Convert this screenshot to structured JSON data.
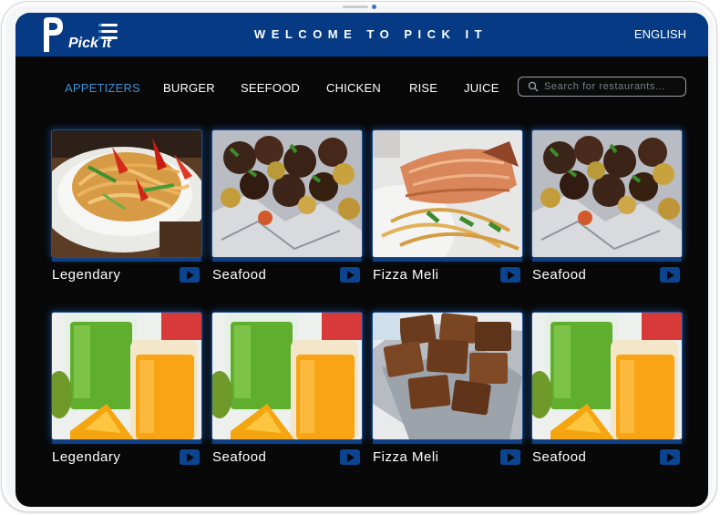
{
  "header": {
    "logo_text": "Pick it",
    "title": "WELCOME TO PICK IT",
    "language": "ENGLISH"
  },
  "nav": {
    "items": [
      {
        "label": "APPETIZERS",
        "active": true
      },
      {
        "label": "BURGER",
        "active": false
      },
      {
        "label": "SEEFOOD",
        "active": false
      },
      {
        "label": "CHICKEN",
        "active": false
      },
      {
        "label": "RISE",
        "active": false
      },
      {
        "label": "JUICE",
        "active": false
      }
    ]
  },
  "search": {
    "placeholder": "Search for restaurants..."
  },
  "cards": [
    {
      "name": "Legendary",
      "image": "noodles-plate"
    },
    {
      "name": "Seafood",
      "image": "roasted-meat-foil"
    },
    {
      "name": "Fizza Meli",
      "image": "salmon-noodles"
    },
    {
      "name": "Seafood",
      "image": "roasted-meat-foil"
    },
    {
      "name": "Legendary",
      "image": "juice-glasses"
    },
    {
      "name": "Seafood",
      "image": "juice-glasses"
    },
    {
      "name": "Fizza Meli",
      "image": "brownies-tray"
    },
    {
      "name": "Seafood",
      "image": "juice-glasses"
    }
  ],
  "icons": {
    "menu": "menu-icon",
    "search": "search-icon",
    "play": "play-icon"
  },
  "colors": {
    "header": "#063a84",
    "accent": "#3d8fd6",
    "screen": "#080808",
    "play_button": "#0b4592"
  }
}
